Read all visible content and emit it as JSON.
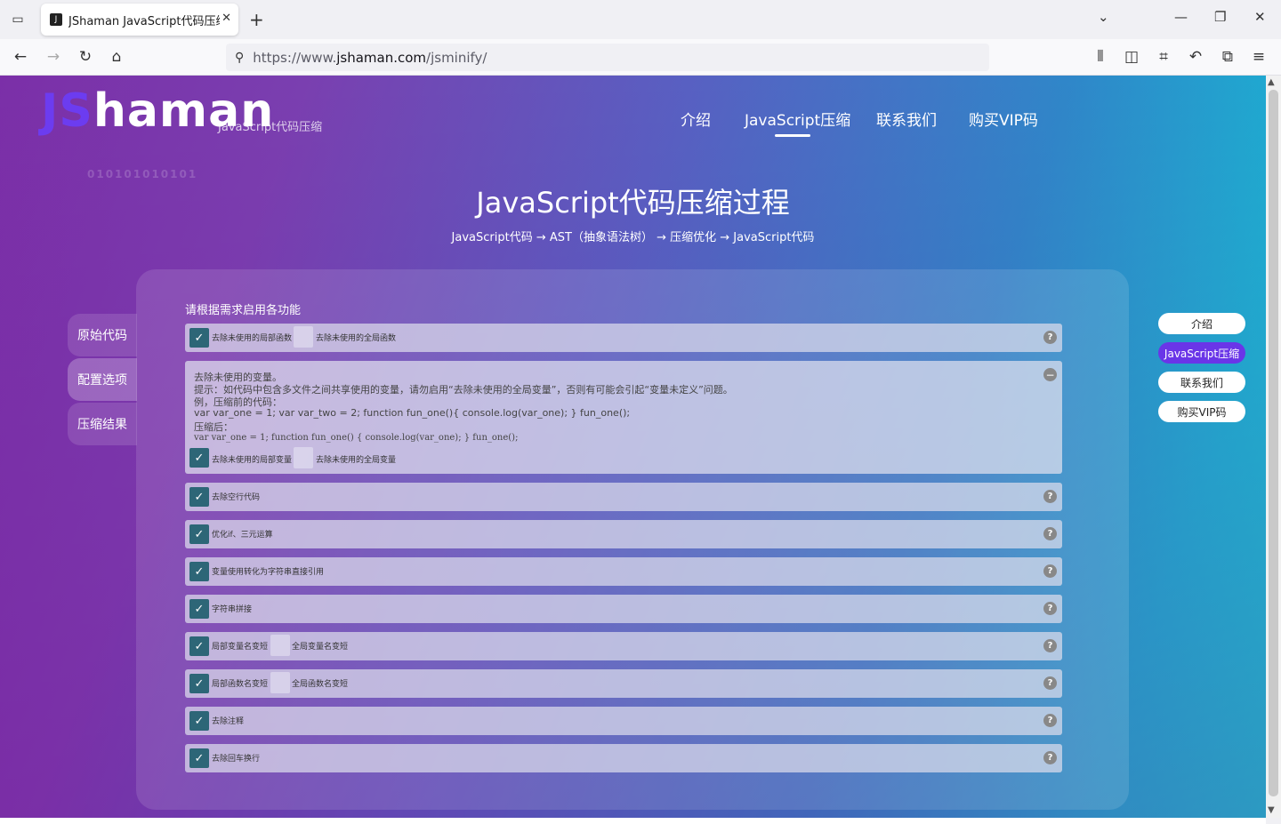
{
  "browser": {
    "tab_title": "JShaman JavaScript代码压缩",
    "url_prefix": "https://www.",
    "url_domain": "jshaman.com",
    "url_path": "/jsminify/"
  },
  "header": {
    "logo_prefix": "JS",
    "logo_rest": "haman",
    "logo_sub": "JavaScript代码压缩",
    "binary_text": "010101010101",
    "nav": [
      "介绍",
      "JavaScript压缩",
      "联系我们",
      "购买VIP码"
    ]
  },
  "hero": {
    "title": "JavaScript代码压缩过程",
    "subtitle": "JavaScript代码 → AST（抽象语法树） → 压缩优化 → JavaScript代码"
  },
  "side_tabs": [
    "原始代码",
    "配置选项",
    "压缩结果"
  ],
  "options": {
    "section_label": "请根据需求启用各功能",
    "rows": [
      {
        "label": "去除未使用的局部函数",
        "label2": "去除未使用的全局函数"
      },
      {
        "label": "去除空行代码"
      },
      {
        "label": "优化if、三元运算"
      },
      {
        "label": "变量使用转化为字符串直接引用"
      },
      {
        "label": "字符串拼接"
      },
      {
        "label": "局部变量名变短",
        "label2": "全局变量名变短"
      },
      {
        "label": "局部函数名变短",
        "label2": "全局函数名变短"
      },
      {
        "label": "去除注释"
      },
      {
        "label": "去除回车换行"
      }
    ],
    "expanded": {
      "lines": [
        "去除未使用的变量。",
        "提示：如代码中包含多文件之间共享使用的变量，请勿启用“去除未使用的全局变量”，否则有可能会引起“变量未定义”问题。",
        "例，压缩前的代码：",
        "var var_one = 1; var var_two = 2; function fun_one(){ console.log(var_one); } fun_one();",
        "压缩后：",
        "var var_one = 1; function fun_one() { console.log(var_one); } fun_one();"
      ],
      "label": "去除未使用的局部变量",
      "label2": "去除未使用的全局变量"
    }
  },
  "right_nav": [
    "介绍",
    "JavaScript压缩",
    "联系我们",
    "购买VIP码"
  ]
}
